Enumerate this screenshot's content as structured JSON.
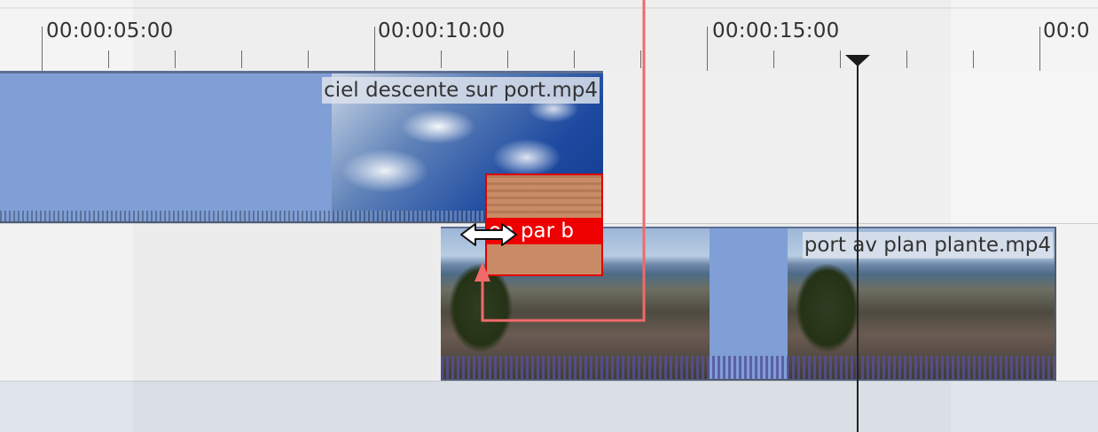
{
  "ruler": {
    "time_labels": [
      "00:00:05:00",
      "00:00:10:00",
      "00:00:15:00",
      "00:0"
    ]
  },
  "clips": {
    "top": {
      "label": "ciel descente sur port.mp4"
    },
    "bottom": {
      "label": "port av plan plante.mp4"
    },
    "transition": {
      "label": "on par b"
    }
  },
  "colors": {
    "clip_blue": "#7f9fd6",
    "transition_red": "#ee0000",
    "annotation_red": "#f06a6a",
    "playhead": "#1a1a1a"
  },
  "icons": {
    "resize_cursor": "double-arrow-horizontal-icon",
    "playhead": "playhead-marker-icon",
    "annotation_arrow": "up-arrow-icon"
  }
}
